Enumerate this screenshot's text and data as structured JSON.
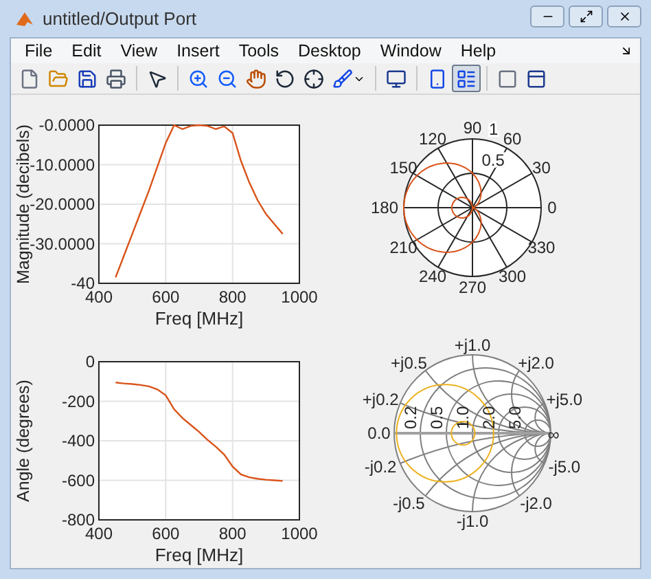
{
  "window": {
    "title": "untitled/Output Port"
  },
  "menu": [
    "File",
    "Edit",
    "View",
    "Insert",
    "Tools",
    "Desktop",
    "Window",
    "Help"
  ],
  "toolbar": [
    {
      "selected": false
    },
    {
      "selected": false
    },
    {
      "selected": false
    },
    {
      "selected": false
    },
    {
      "selected": false
    },
    {
      "selected": false
    },
    {
      "selected": false
    },
    {
      "selected": false
    },
    {
      "selected": false
    },
    {
      "selected": false
    },
    {
      "selected": false
    },
    {
      "selected": false
    },
    {
      "selected": false
    },
    {
      "selected": true
    },
    {
      "selected": false
    },
    {
      "selected": false
    }
  ],
  "magnitude_plot": {
    "chart_data": {
      "type": "line",
      "xlabel": "Freq [MHz]",
      "ylabel": "Magnitude (decibels)",
      "x": [
        450,
        475,
        500,
        525,
        550,
        575,
        600,
        625,
        650,
        675,
        700,
        725,
        750,
        775,
        800,
        825,
        850,
        875,
        900,
        925,
        950
      ],
      "series": [
        {
          "color": "#d95319",
          "values": [
            -38.5,
            -33,
            -27.5,
            -22,
            -16.5,
            -10.5,
            -4.5,
            0,
            -1,
            -0.2,
            0,
            -0.2,
            -1,
            -0.3,
            -2,
            -9,
            -14.5,
            -19,
            -22.5,
            -25,
            -27.5
          ]
        }
      ],
      "xlim": [
        400,
        1000
      ],
      "ylim": [
        -40,
        0
      ],
      "grid": true,
      "xticks": [
        400,
        600,
        800,
        1000
      ],
      "yticks": [
        {
          "value": -40,
          "label": "-40"
        },
        {
          "value": -30,
          "label": "-30.0000"
        },
        {
          "value": -20,
          "label": "-20.0000"
        },
        {
          "value": -10,
          "label": "-10.0000"
        },
        {
          "value": 0,
          "label": "-0.0000"
        }
      ]
    }
  },
  "polar_plot": {
    "angle_labels": [
      "0",
      "30",
      "60",
      "90",
      "120",
      "150",
      "180",
      "210",
      "240",
      "270",
      "300",
      "330"
    ],
    "radius_labels": [
      "1",
      "0.5"
    ]
  },
  "angle_plot": {
    "chart_data": {
      "type": "line",
      "xlabel": "Freq [MHz]",
      "ylabel": "Angle (degrees)",
      "x": [
        450,
        475,
        500,
        525,
        550,
        575,
        600,
        625,
        650,
        675,
        700,
        725,
        750,
        775,
        800,
        825,
        850,
        875,
        900,
        925,
        950
      ],
      "series": [
        {
          "color": "#d95319",
          "values": [
            -105,
            -110,
            -113,
            -118,
            -125,
            -140,
            -170,
            -240,
            -285,
            -320,
            -355,
            -395,
            -430,
            -470,
            -530,
            -570,
            -585,
            -592,
            -597,
            -600,
            -603
          ]
        }
      ],
      "xlim": [
        400,
        1000
      ],
      "ylim": [
        -800,
        0
      ],
      "grid": true,
      "xticks": [
        400,
        600,
        800,
        1000
      ],
      "yticks": [
        {
          "value": -800,
          "label": "-800"
        },
        {
          "value": -600,
          "label": "-600"
        },
        {
          "value": -400,
          "label": "-400"
        },
        {
          "value": -200,
          "label": "-200"
        },
        {
          "value": 0,
          "label": "0"
        }
      ]
    }
  },
  "smith_chart": {
    "reactance_labels": [
      "+j0.2",
      "+j0.5",
      "+j1.0",
      "+j2.0",
      "+j5.0",
      "-j0.2",
      "-j0.5",
      "-j1.0",
      "-j2.0",
      "-j5.0"
    ],
    "resistance_labels": [
      "0.0",
      "0.2",
      "0.5",
      "1.0",
      "2.0",
      "5.0",
      "∞"
    ]
  }
}
